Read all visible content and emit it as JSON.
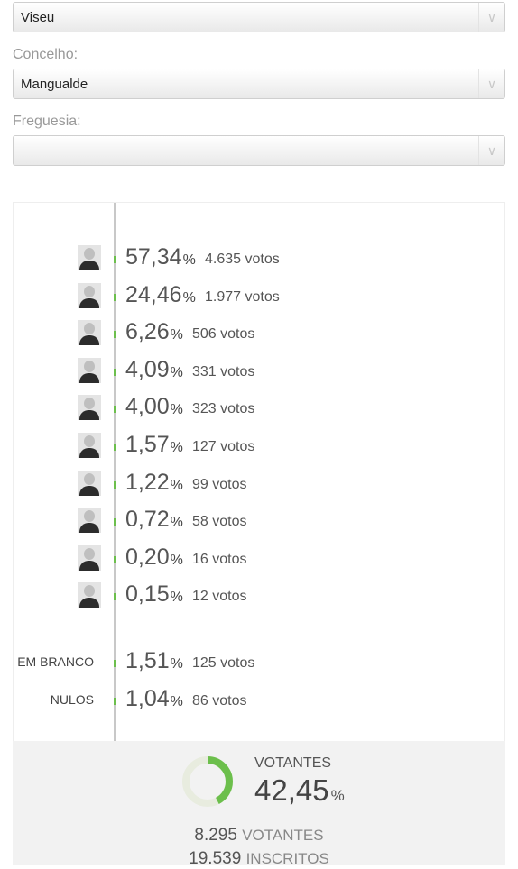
{
  "filters": {
    "distrito": {
      "value": "Viseu"
    },
    "concelho": {
      "label": "Concelho:",
      "value": "Mangualde"
    },
    "freguesia": {
      "label": "Freguesia:",
      "value": ""
    },
    "arrow_icon": "chevron-down-icon"
  },
  "results": {
    "percent_sign": "%",
    "candidates": [
      {
        "percent": "57,34",
        "votes": "4.635 votos"
      },
      {
        "percent": "24,46",
        "votes": "1.977 votos"
      },
      {
        "percent": "6,26",
        "votes": "506 votos"
      },
      {
        "percent": "4,09",
        "votes": "331 votos"
      },
      {
        "percent": "4,00",
        "votes": "323 votos"
      },
      {
        "percent": "1,57",
        "votes": "127 votos"
      },
      {
        "percent": "1,22",
        "votes": "99 votos"
      },
      {
        "percent": "0,72",
        "votes": "58 votos"
      },
      {
        "percent": "0,20",
        "votes": "16 votos"
      },
      {
        "percent": "0,15",
        "votes": "12 votos"
      }
    ],
    "others": [
      {
        "label": "EM BRANCO",
        "percent": "1,51",
        "votes": "125 votos"
      },
      {
        "label": "NULOS",
        "percent": "1,04",
        "votes": "86 votos"
      }
    ],
    "bar_color": "#6cbf4c"
  },
  "summary": {
    "votantes_label": "VOTANTES",
    "votantes_percent": "42,45",
    "votantes_fraction": 0.4245,
    "percent_sign": "%",
    "votantes_count": "8.295",
    "votantes_unit": "VOTANTES",
    "inscritos_count": "19.539",
    "inscritos_unit": "INSCRITOS",
    "accent": "#6cbf4c"
  }
}
